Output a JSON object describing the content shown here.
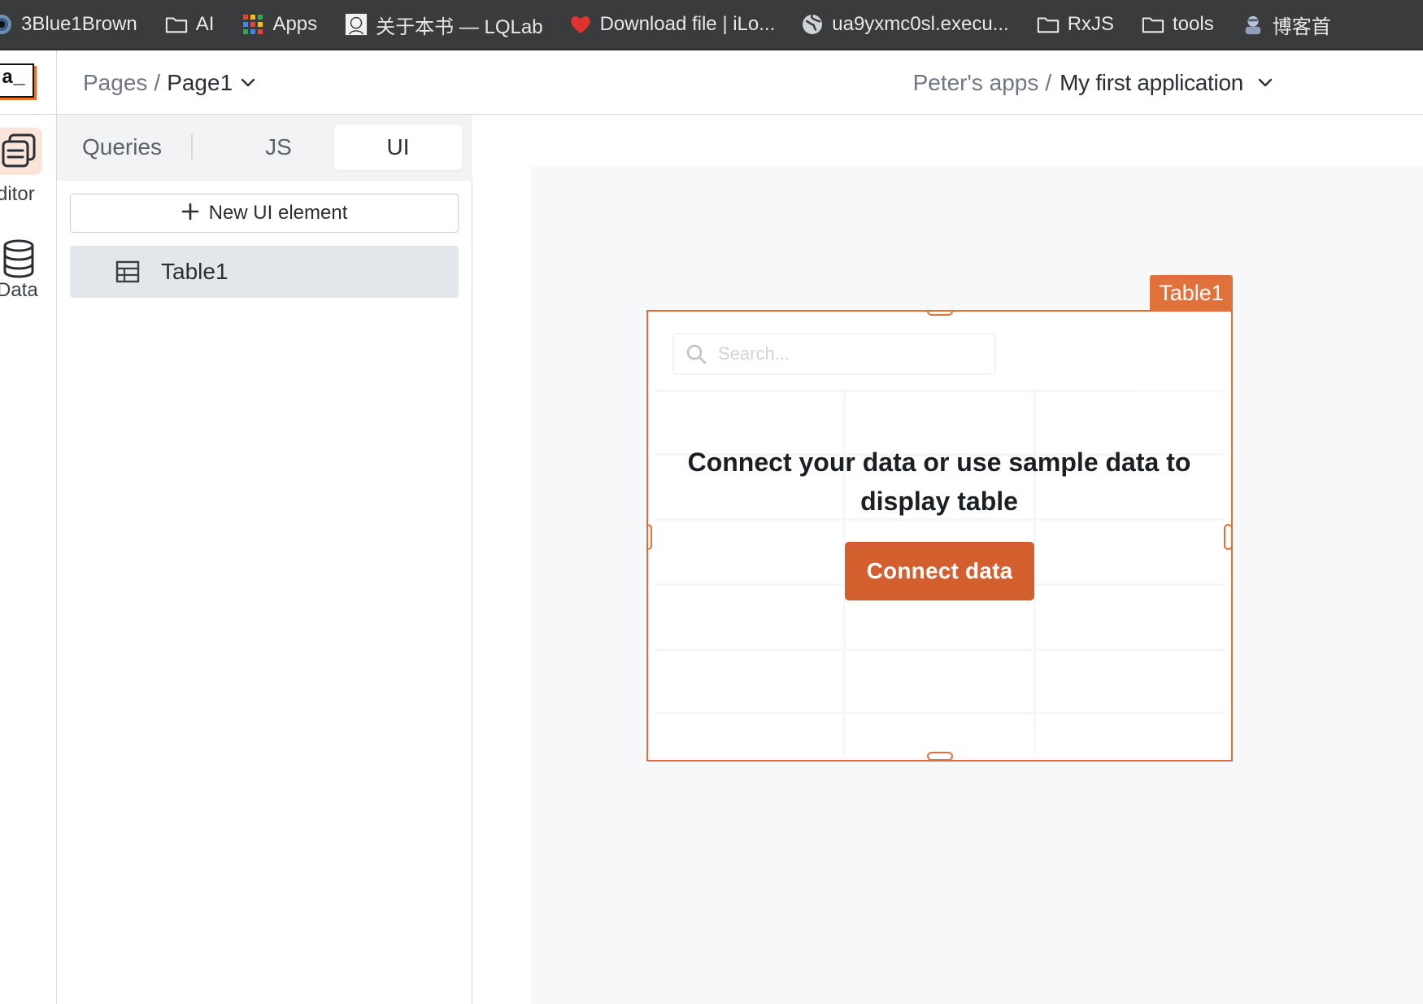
{
  "bookmarks": [
    {
      "label": "3Blue1Brown",
      "icon": "3b1b-eye-icon"
    },
    {
      "label": "AI",
      "icon": "folder-icon"
    },
    {
      "label": "Apps",
      "icon": "apps-grid-icon"
    },
    {
      "label": "关于本书 — LQLab",
      "icon": "portrait-icon"
    },
    {
      "label": "Download file | iLo...",
      "icon": "heart-icon"
    },
    {
      "label": "ua9yxmc0sl.execu...",
      "icon": "globe-icon"
    },
    {
      "label": "RxJS",
      "icon": "folder-icon"
    },
    {
      "label": "tools",
      "icon": "folder-icon"
    },
    {
      "label": "博客首",
      "icon": "avatar-icon"
    }
  ],
  "header": {
    "logo_text": "a_",
    "pages_label": "Pages",
    "separator": "/",
    "current_page": "Page1",
    "workspace": "Peter's apps",
    "app_name": "My first application"
  },
  "rail": {
    "editor_label": "ditor",
    "data_label": "Data"
  },
  "sidebar": {
    "tabs": [
      "Queries",
      "JS",
      "UI"
    ],
    "active_tab": "UI",
    "new_button_label": "New UI element",
    "items": [
      {
        "label": "Table1"
      }
    ]
  },
  "widget": {
    "name": "Table1",
    "search_placeholder": "Search...",
    "empty_message": "Connect your data or use sample data to display table",
    "connect_button": "Connect data"
  },
  "colors": {
    "accent": "#e1713a",
    "button": "#d35f2f",
    "bookmark_bar": "#3a3b3d"
  }
}
